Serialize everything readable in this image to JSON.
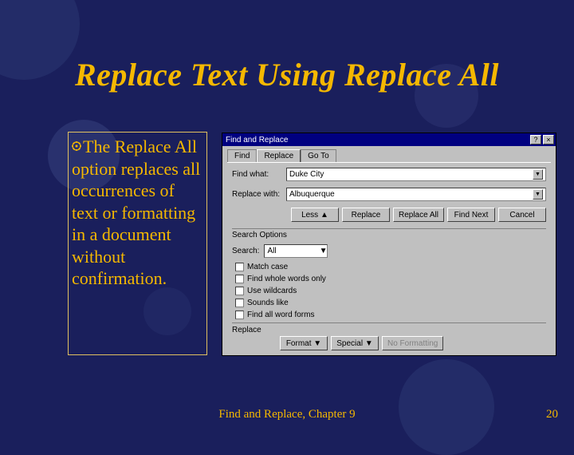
{
  "slide": {
    "title": "Replace Text Using Replace All",
    "bullet_text": "The Replace All option replaces all occurrences of text or formatting in a document without confirmation.",
    "footer_center": "Find and Replace, Chapter 9",
    "page_number": "20"
  },
  "dialog": {
    "titlebar": "Find and Replace",
    "help_btn": "?",
    "close_btn": "×",
    "tabs": {
      "find": "Find",
      "replace": "Replace",
      "goto": "Go To"
    },
    "find_label": "Find what:",
    "find_value": "Duke City",
    "replace_label": "Replace with:",
    "replace_value": "Albuquerque",
    "buttons": {
      "less": "Less ▲",
      "replace": "Replace",
      "replace_all": "Replace All",
      "find_next": "Find Next",
      "cancel": "Cancel"
    },
    "search_options_title": "Search Options",
    "search_label": "Search:",
    "search_value": "All",
    "checks": {
      "match_case": "Match case",
      "whole_words": "Find whole words only",
      "wildcards": "Use wildcards",
      "sounds_like": "Sounds like",
      "word_forms": "Find all word forms"
    },
    "replace_group": "Replace",
    "bottom": {
      "format": "Format ▼",
      "special": "Special ▼",
      "no_formatting": "No Formatting"
    }
  }
}
